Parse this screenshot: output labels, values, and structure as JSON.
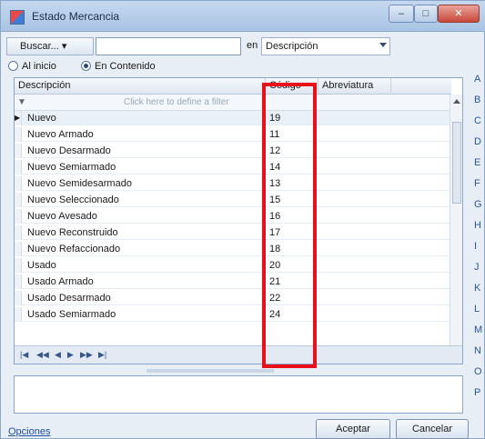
{
  "window": {
    "title": "Estado Mercancia",
    "minimize": "–",
    "maximize": "□",
    "close": "✕"
  },
  "toolbar": {
    "search_button": "Buscar...",
    "search_value": "",
    "en_label": "en",
    "field_value": "Descripción"
  },
  "radios": [
    {
      "label": "Al inicio",
      "checked": false
    },
    {
      "label": "En Contenido",
      "checked": true
    }
  ],
  "grid": {
    "headers": [
      "Descripción",
      "Código",
      "Abreviatura"
    ],
    "filter_hint": "Click here to define a filter",
    "rows": [
      {
        "descripcion": "Nuevo",
        "codigo": "19",
        "abreviatura": ""
      },
      {
        "descripcion": "Nuevo Armado",
        "codigo": "11",
        "abreviatura": ""
      },
      {
        "descripcion": "Nuevo Desarmado",
        "codigo": "12",
        "abreviatura": ""
      },
      {
        "descripcion": "Nuevo Semiarmado",
        "codigo": "14",
        "abreviatura": ""
      },
      {
        "descripcion": "Nuevo Semidesarmado",
        "codigo": "13",
        "abreviatura": ""
      },
      {
        "descripcion": "Nuevo Seleccionado",
        "codigo": "15",
        "abreviatura": ""
      },
      {
        "descripcion": "Nuevo Avesado",
        "codigo": "16",
        "abreviatura": ""
      },
      {
        "descripcion": "Nuevo Reconstruido",
        "codigo": "17",
        "abreviatura": ""
      },
      {
        "descripcion": "Nuevo Refaccionado",
        "codigo": "18",
        "abreviatura": ""
      },
      {
        "descripcion": "Usado",
        "codigo": "20",
        "abreviatura": ""
      },
      {
        "descripcion": "Usado Armado",
        "codigo": "21",
        "abreviatura": ""
      },
      {
        "descripcion": "Usado Desarmado",
        "codigo": "22",
        "abreviatura": ""
      },
      {
        "descripcion": "Usado Semiarmado",
        "codigo": "24",
        "abreviatura": ""
      }
    ],
    "nav": [
      "|◀",
      "◀◀",
      "◀",
      "▶",
      "▶▶",
      "▶|"
    ]
  },
  "footer": {
    "link": "Opciones",
    "accept": "Aceptar",
    "cancel": "Cancelar"
  },
  "alphabet": [
    "A",
    "B",
    "C",
    "D",
    "E",
    "F",
    "G",
    "H",
    "I",
    "J",
    "K",
    "L",
    "M",
    "N",
    "O",
    "P"
  ],
  "colors": {
    "highlight": "#e8101a",
    "link": "#1f4fa0"
  }
}
